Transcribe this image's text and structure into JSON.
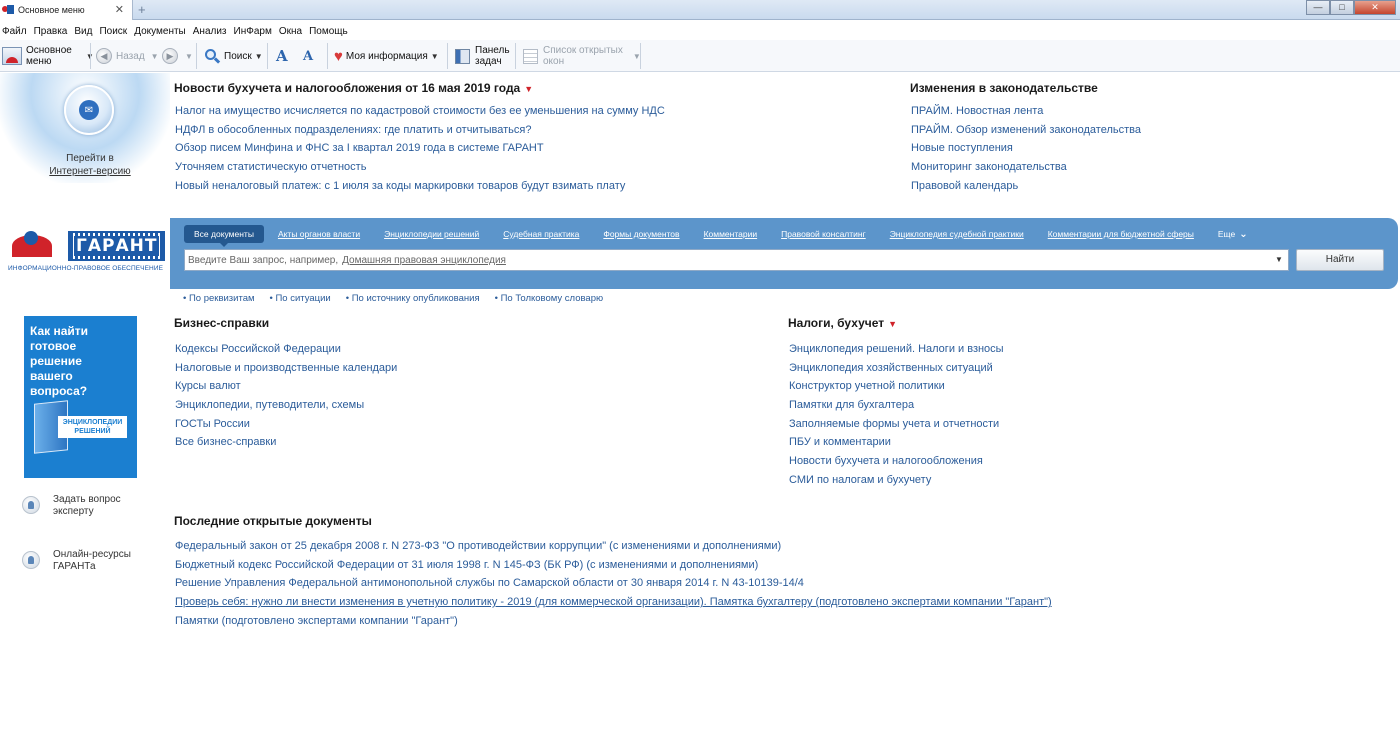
{
  "window": {
    "tab_title": "Основное меню",
    "tab_close": "✕",
    "new_tab": "+",
    "minimize": "—",
    "maximize": "□",
    "close": "✕"
  },
  "menu": [
    "Файл",
    "Правка",
    "Вид",
    "Поиск",
    "Документы",
    "Анализ",
    "ИнФарм",
    "Окна",
    "Помощь"
  ],
  "toolbar": {
    "main_menu_line1": "Основное",
    "main_menu_line2": "меню",
    "back": "Назад",
    "search": "Поиск",
    "font_big": "A",
    "font_small": "A",
    "my_info": "Моя информация",
    "panel_line1": "Панель",
    "panel_line2": "задач",
    "open_windows_line1": "Список открытых",
    "open_windows_line2": "окон"
  },
  "left": {
    "goto_line1": "Перейти в",
    "goto_line2": "Интернет-версию",
    "logo_word": "ГАРАНТ",
    "logo_tagline": "ИНФОРМАЦИОННО-ПРАВОВОЕ ОБЕСПЕЧЕНИЕ",
    "promo_line1": "Как найти",
    "promo_line2": "готовое решение",
    "promo_line3": "вашего вопроса?",
    "promo_book_line1": "ЭНЦИКЛОПЕДИИ",
    "promo_book_line2": "РЕШЕНИЙ",
    "ask_line1": "Задать вопрос",
    "ask_line2": "эксперту",
    "online_line1": "Онлайн-ресурсы",
    "online_line2": "ГАРАНТа"
  },
  "news": {
    "title": "Новости бухучета и налогообложения от 16 мая 2019 года",
    "items": [
      "Налог на имущество исчисляется по кадастровой стоимости без ее уменьшения на сумму НДС",
      "НДФЛ в обособленных подразделениях: где платить и отчитываться?",
      "Обзор писем Минфина и ФНС за I квартал 2019 года в системе ГАРАНТ",
      "Уточняем статистическую отчетность",
      "Новый неналоговый платеж: с 1 июля за коды маркировки товаров будут взимать плату"
    ]
  },
  "law_changes": {
    "title": "Изменения в законодательстве",
    "items": [
      "ПРАЙМ. Новостная лента",
      "ПРАЙМ. Обзор изменений законодательства",
      "Новые поступления",
      "Мониторинг законодательства",
      "Правовой календарь"
    ]
  },
  "search": {
    "tabs": [
      "Все документы",
      "Акты органов власти",
      "Энциклопедии решений",
      "Судебная практика",
      "Формы документов",
      "Комментарии",
      "Правовой консалтинг",
      "Энциклопедия судебной практики",
      "Комментарии для бюджетной сферы",
      "Еще"
    ],
    "placeholder_prefix": "Введите Ваш запрос, например,",
    "placeholder_example": "Домашняя правовая энциклопедия",
    "button": "Найти",
    "search_by": [
      "• По реквизитам",
      "• По ситуации",
      "• По источнику опубликования",
      "• По Толковому словарю"
    ]
  },
  "business": {
    "title": "Бизнес-справки",
    "items": [
      "Кодексы Российской Федерации",
      "Налоговые и производственные календари",
      "Курсы валют",
      "Энциклопедии, путеводители, схемы",
      "ГОСТы России",
      "Все бизнес-справки"
    ]
  },
  "taxes": {
    "title": "Налоги, бухучет",
    "items": [
      "Энциклопедия решений. Налоги и взносы",
      "Энциклопедия хозяйственных ситуаций",
      "Конструктор учетной политики",
      "Памятки для бухгалтера",
      "Заполняемые формы учета и отчетности",
      "ПБУ и комментарии",
      "Новости бухучета и налогообложения",
      "СМИ по налогам и бухучету"
    ]
  },
  "recent": {
    "title": "Последние открытые документы",
    "items": [
      "Федеральный закон от 25 декабря 2008 г. N 273-ФЗ \"О противодействии коррупции\" (с изменениями и дополнениями)",
      "Бюджетный кодекс Российской Федерации от 31 июля 1998 г. N 145-ФЗ (БК РФ) (с изменениями и дополнениями)",
      "Решение Управления Федеральной антимонопольной службы по Самарской области от 30 января 2014 г. N 43-10139-14/4",
      "Проверь себя: нужно ли внести изменения в учетную политику - 2019 (для коммерческой организации). Памятка бухгалтеру (подготовлено экспертами компании \"Гарант\")",
      "Памятки (подготовлено экспертами компании \"Гарант\")"
    ]
  }
}
